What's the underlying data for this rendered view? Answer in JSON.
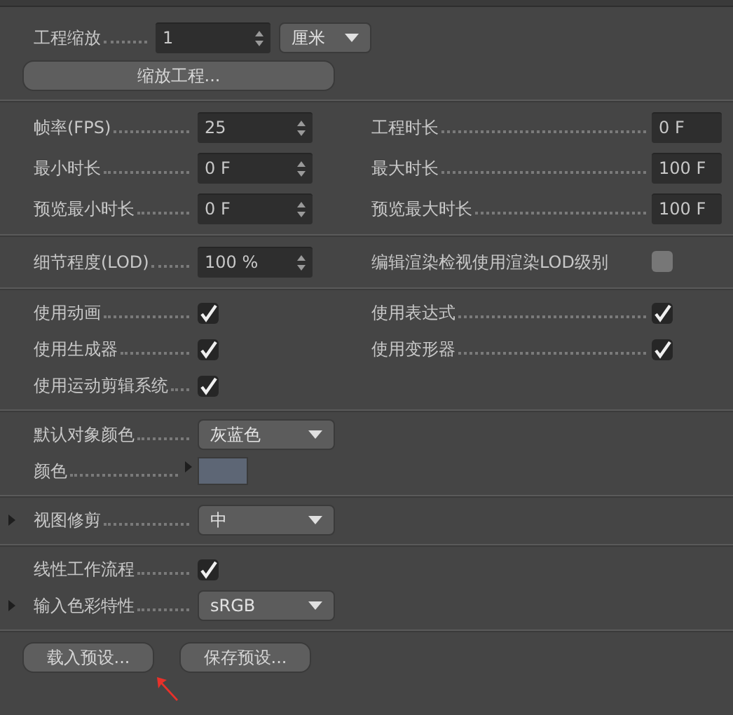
{
  "sections": [
    {
      "rows": [
        {
          "left": [
            {
              "kind": "number",
              "label": "工程缩放",
              "value": "1"
            },
            {
              "kind": "dropdown",
              "value": "厘米"
            }
          ]
        },
        {
          "left": [
            {
              "kind": "button",
              "label": "缩放工程..."
            }
          ]
        }
      ]
    },
    {
      "rows": [
        {
          "left": [
            {
              "kind": "number",
              "label": "帧率(FPS)",
              "value": "25"
            }
          ],
          "right": [
            {
              "kind": "field",
              "label": "工程时长",
              "value": "0 F"
            }
          ]
        },
        {
          "left": [
            {
              "kind": "number",
              "label": "最小时长",
              "value": "0 F"
            }
          ],
          "right": [
            {
              "kind": "field",
              "label": "最大时长",
              "value": "100 F"
            }
          ]
        },
        {
          "left": [
            {
              "kind": "number",
              "label": "预览最小时长",
              "value": "0 F"
            }
          ],
          "right": [
            {
              "kind": "field",
              "label": "预览最大时长",
              "value": "100 F"
            }
          ]
        }
      ]
    },
    {
      "rows": [
        {
          "left": [
            {
              "kind": "number",
              "label": "细节程度(LOD)",
              "value": "100 %"
            }
          ],
          "right": [
            {
              "kind": "checkbox",
              "label": "编辑渲染检视使用渲染LOD级别",
              "checked": false
            }
          ]
        }
      ]
    },
    {
      "rows": [
        {
          "left": [
            {
              "kind": "checkbox",
              "label": "使用动画",
              "checked": true
            }
          ],
          "right": [
            {
              "kind": "checkbox",
              "label": "使用表达式",
              "checked": true
            }
          ]
        },
        {
          "left": [
            {
              "kind": "checkbox",
              "label": "使用生成器",
              "checked": true
            }
          ],
          "right": [
            {
              "kind": "checkbox",
              "label": "使用变形器",
              "checked": true
            }
          ]
        },
        {
          "left": [
            {
              "kind": "checkbox",
              "label": "使用运动剪辑系统",
              "checked": true
            }
          ]
        }
      ]
    },
    {
      "rows": [
        {
          "left": [
            {
              "kind": "dropdown",
              "label": "默认对象颜色",
              "value": "灰蓝色"
            }
          ]
        },
        {
          "left": [
            {
              "kind": "color",
              "label": "颜色",
              "color": "#5d6675",
              "expanded": false
            }
          ]
        }
      ]
    },
    {
      "rows": [
        {
          "left": [
            {
              "kind": "dropdown",
              "label": "视图修剪",
              "value": "中",
              "expanded": false
            }
          ]
        }
      ]
    },
    {
      "rows": [
        {
          "left": [
            {
              "kind": "checkbox",
              "label": "线性工作流程",
              "checked": true
            }
          ]
        },
        {
          "left": [
            {
              "kind": "dropdown",
              "label": "输入色彩特性",
              "value": "sRGB",
              "expanded": false
            }
          ]
        }
      ]
    },
    {
      "rows": [
        {
          "left": [
            {
              "kind": "button",
              "label": "载入预设..."
            },
            {
              "kind": "button",
              "label": "保存预设..."
            }
          ]
        }
      ]
    }
  ]
}
